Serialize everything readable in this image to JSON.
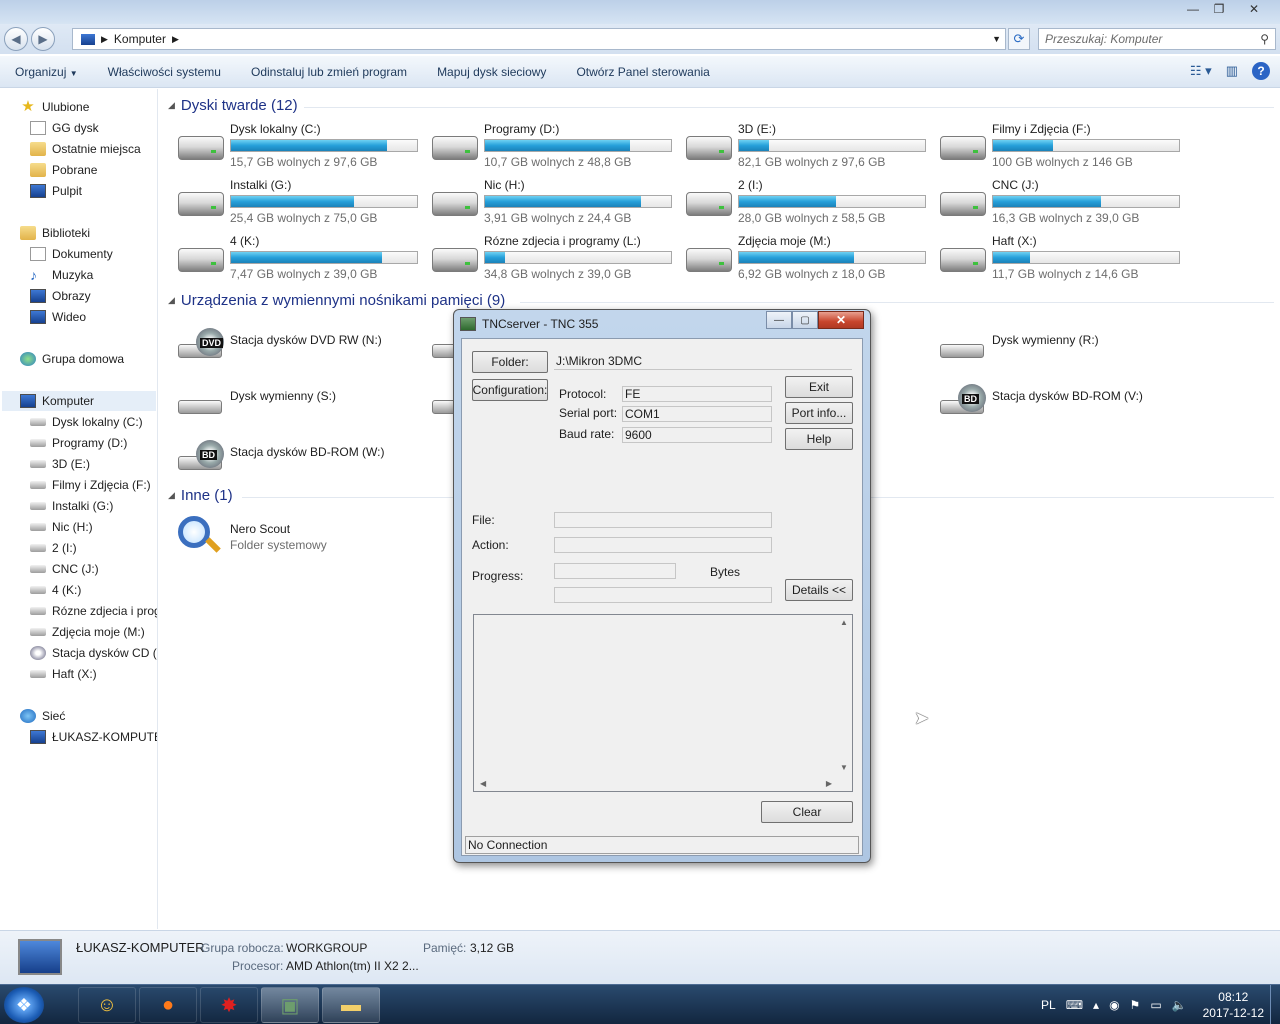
{
  "window": {
    "controls": {
      "minimize": "▭",
      "maximize": "▢",
      "close": "✕"
    }
  },
  "address": {
    "location": "Komputer",
    "search_placeholder": "Przeszukaj: Komputer"
  },
  "toolbar": {
    "commands": [
      "Organizuj",
      "Właściwości systemu",
      "Odinstaluj lub zmień program",
      "Mapuj dysk sieciowy",
      "Otwórz Panel sterowania"
    ]
  },
  "sidebar": {
    "favorites": {
      "label": "Ulubione",
      "items": [
        "GG dysk",
        "Ostatnie miejsca",
        "Pobrane",
        "Pulpit"
      ]
    },
    "libraries": {
      "label": "Biblioteki",
      "items": [
        "Dokumenty",
        "Muzyka",
        "Obrazy",
        "Wideo"
      ]
    },
    "homegroup": "Grupa domowa",
    "computer": {
      "label": "Komputer",
      "items": [
        "Dysk lokalny (C:)",
        "Programy (D:)",
        "3D (E:)",
        "Filmy i Zdjęcia  (F:)",
        "Instalki (G:)",
        "Nic (H:)",
        "2 (I:)",
        "CNC (J:)",
        "4 (K:)",
        "Rózne zdjecia i prog",
        "Zdjęcia moje (M:)",
        "Stacja dysków CD (C",
        "Haft (X:)"
      ]
    },
    "network": {
      "label": "Sieć",
      "items": [
        "ŁUKASZ-KOMPUTER"
      ]
    }
  },
  "sections": {
    "hard_disks": "Dyski twarde (12)",
    "removable": "Urządzenia z wymiennymi nośnikami pamięci (9)",
    "other": "Inne (1)"
  },
  "drives": [
    {
      "name": "Dysk lokalny (C:)",
      "free": "15,7 GB wolnych z 97,6 GB",
      "used": 0.84
    },
    {
      "name": "Programy (D:)",
      "free": "10,7 GB wolnych z 48,8 GB",
      "used": 0.78
    },
    {
      "name": "3D (E:)",
      "free": "82,1 GB wolnych z 97,6 GB",
      "used": 0.16
    },
    {
      "name": "Filmy i Zdjęcia  (F:)",
      "free": "100 GB wolnych z 146 GB",
      "used": 0.32
    },
    {
      "name": "Instalki (G:)",
      "free": "25,4 GB wolnych z 75,0 GB",
      "used": 0.66
    },
    {
      "name": "Nic (H:)",
      "free": "3,91 GB wolnych z 24,4 GB",
      "used": 0.84
    },
    {
      "name": "2 (I:)",
      "free": "28,0 GB wolnych z 58,5 GB",
      "used": 0.52
    },
    {
      "name": "CNC (J:)",
      "free": "16,3 GB wolnych z 39,0 GB",
      "used": 0.58
    },
    {
      "name": "4 (K:)",
      "free": "7,47 GB wolnych z 39,0 GB",
      "used": 0.81
    },
    {
      "name": "Rózne zdjecia i programy (L:)",
      "free": "34,8 GB wolnych z 39,0 GB",
      "used": 0.11
    },
    {
      "name": "Zdjęcia moje (M:)",
      "free": "6,92 GB wolnych z 18,0 GB",
      "used": 0.62
    },
    {
      "name": "Haft (X:)",
      "free": "11,7 GB wolnych z 14,6 GB",
      "used": 0.2
    }
  ],
  "removable_devices": [
    {
      "name": "Stacja dysków DVD RW (N:)",
      "badge": "DVD"
    },
    {
      "name": "Dysk wymienny (R:)",
      "badge": ""
    },
    {
      "name": "Dysk wymienny (S:)",
      "badge": ""
    },
    {
      "name": "Stacja dysków BD-ROM (V:)",
      "badge": "BD"
    },
    {
      "name": "Stacja dysków BD-ROM (W:)",
      "badge": "BD"
    }
  ],
  "other_items": [
    {
      "name": "Nero Scout",
      "type": "Folder systemowy"
    }
  ],
  "details": {
    "computer_name": "ŁUKASZ-KOMPUTER",
    "workgroup_label": "Grupa robocza:",
    "workgroup": "WORKGROUP",
    "memory_label": "Pamięć:",
    "memory": "3,12 GB",
    "cpu_label": "Procesor:",
    "cpu": "AMD Athlon(tm) II X2 2..."
  },
  "dialog": {
    "title": "TNCserver - TNC 355",
    "folder_button": "Folder:",
    "folder_path": "J:\\Mikron 3DMC",
    "config_button": "Configuration:",
    "protocol_label": "Protocol:",
    "protocol": "FE",
    "serial_label": "Serial port:",
    "serial": "COM1",
    "baud_label": "Baud rate:",
    "baud": "9600",
    "exit": "Exit",
    "port_info": "Port info...",
    "help": "Help",
    "file_label": "File:",
    "action_label": "Action:",
    "progress_label": "Progress:",
    "bytes_label": "Bytes",
    "details_button": "Details <<",
    "clear": "Clear",
    "status": "No Connection"
  },
  "taskbar": {
    "lang": "PL",
    "time": "08:12",
    "date": "2017-12-12"
  }
}
